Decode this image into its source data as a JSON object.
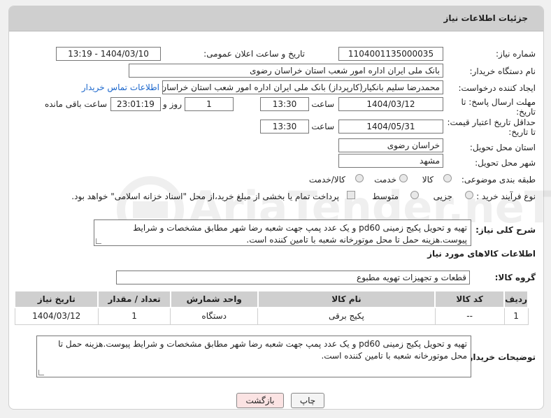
{
  "header": {
    "title": "جزئیات اطلاعات نیاز"
  },
  "fields": {
    "need_number_label": "شماره نیاز:",
    "need_number": "1104001135000035",
    "announce_label": "تاریخ و ساعت اعلان عمومی:",
    "announce_value": "1404/03/10 - 13:19",
    "buyer_org_label": "نام دستگاه خریدار:",
    "buyer_org": "بانک ملی ایران اداره امور شعب استان خراسان رضوی",
    "requester_label": "ایجاد کننده درخواست:",
    "requester": "محمدرضا سلیم  بانکیار(کارپرداز) بانک ملی ایران اداره امور شعب استان خراسان",
    "contact_link": "اطلاعات تماس خریدار",
    "reply_deadline_label_1": "مهلت ارسال پاسخ: تا",
    "reply_deadline_label_2": "تاریخ:",
    "reply_date": "1404/03/12",
    "time_label": "ساعت",
    "reply_time": "13:30",
    "days_value": "1",
    "days_label": "روز و",
    "remaining_time": "23:01:19",
    "remaining_label": "ساعت باقی مانده",
    "price_validity_label_1": "حداقل تاریخ اعتبار قیمت:",
    "price_validity_label_2": "تا تاریخ:",
    "price_date": "1404/05/31",
    "price_time": "13:30",
    "delivery_province_label": "استان محل تحویل:",
    "delivery_province": "خراسان رضوی",
    "delivery_city_label": "شهر محل تحویل:",
    "delivery_city": "مشهد",
    "category_label": "طبقه بندی موضوعی:",
    "category_options": [
      "کالا",
      "خدمت",
      "کالا/خدمت"
    ],
    "process_label": "نوع فرآیند خرید :",
    "process_options": [
      "جزیی",
      "متوسط"
    ],
    "payment_note": "پرداخت تمام یا بخشی از مبلغ خرید،از محل \"اسناد خزانه اسلامی\" خواهد بود.",
    "description_label": "شرح کلی نیاز:",
    "description": "تهیه و تحویل پکیج زمینی pd60 و یک عدد پمپ جهت شعبه رضا شهر مطابق مشخصات و شرایط پیوست.هزینه حمل تا محل موتورخانه شعبه با تامین کننده است.",
    "goods_info_title": "اطلاعات کالاهای مورد نیاز",
    "goods_group_label": "گروه کالا:",
    "goods_group": "قطعات و تجهیزات تهویه مطبوع",
    "buyer_notes_label": "توضیحات خریدار:",
    "buyer_notes": "تهیه و تحویل پکیج زمینی pd60 و یک عدد پمپ جهت شعبه رضا شهر مطابق مشخصات و شرایط پیوست.هزینه حمل تا محل موتورخانه شعبه با تامین کننده است."
  },
  "table": {
    "headers": [
      "ردیف",
      "کد کالا",
      "نام کالا",
      "واحد شمارش",
      "تعداد / مقدار",
      "تاریخ نیاز"
    ],
    "rows": [
      [
        "1",
        "--",
        "پکیج برقی",
        "دستگاه",
        "1",
        "1404/03/12"
      ]
    ]
  },
  "buttons": {
    "print": "چاپ",
    "back": "بازگشت"
  },
  "watermark": "AriaTender.neT",
  "colors": {
    "header_bg": "#cfcfcf",
    "link": "#1a66cc",
    "back_btn_bg": "#fbe3e3"
  }
}
